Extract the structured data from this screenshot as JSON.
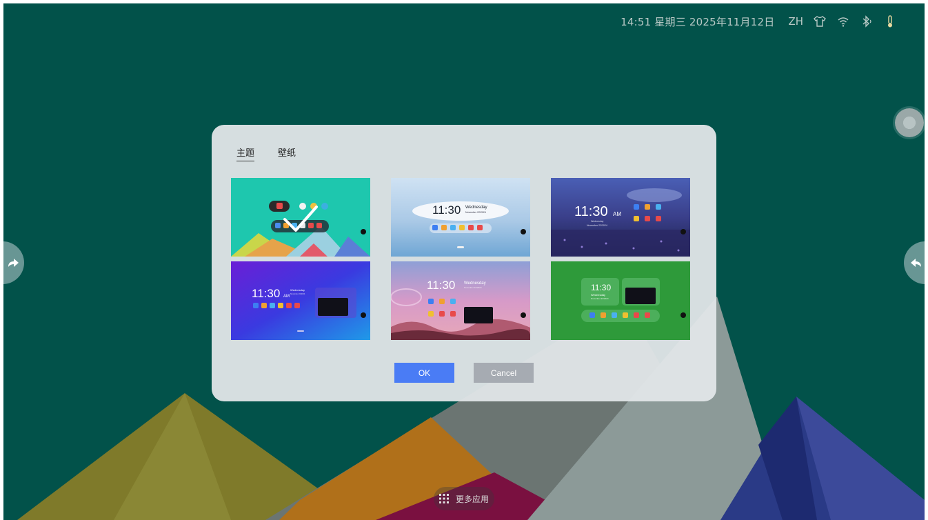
{
  "status_bar": {
    "datetime": "14:51 星期三 2025年11月12日",
    "language": "ZH",
    "icons": [
      "tshirt-icon",
      "wifi-icon",
      "bluetooth-icon",
      "thermometer-icon"
    ]
  },
  "dialog": {
    "tabs": [
      {
        "label": "主题",
        "active": true
      },
      {
        "label": "壁纸",
        "active": false
      }
    ],
    "themes": [
      {
        "name": "teal-polygon",
        "selected": true,
        "clock": "",
        "day": "",
        "date": ""
      },
      {
        "name": "lake-blue",
        "selected": false,
        "clock": "11:30",
        "day": "Wednesday",
        "date": "November 22/2024"
      },
      {
        "name": "night-meadow",
        "selected": false,
        "clock": "11:30",
        "ampm": "AM",
        "day": "Wednesday",
        "date": "November 22/2024"
      },
      {
        "name": "purple-gradient",
        "selected": false,
        "clock": "11:30",
        "ampm": "AM",
        "day": "Wednesday",
        "date": "November 22/2024"
      },
      {
        "name": "pink-dunes",
        "selected": false,
        "clock": "11:30",
        "day": "Wednesday",
        "date": "November 22/2024"
      },
      {
        "name": "green-widgets",
        "selected": false,
        "clock": "11:30",
        "day": "Wednesday",
        "date": "November 22/2024"
      }
    ],
    "ok_label": "OK",
    "cancel_label": "Cancel"
  },
  "dock": {
    "label": "更多应用"
  },
  "colors": {
    "background": "#02524a",
    "ok_button": "#4a7cf5",
    "cancel_button": "#a6abb2",
    "dialog": "#e2e6e8"
  }
}
